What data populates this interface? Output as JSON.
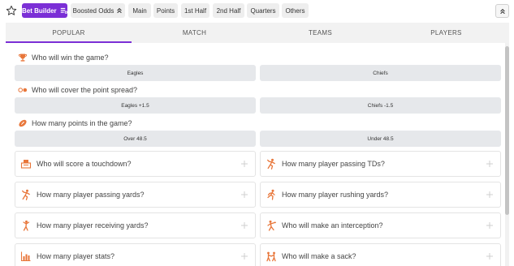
{
  "filters": {
    "bet_builder": "Bet Builder",
    "chips": [
      "Boosted Odds",
      "Main",
      "Points",
      "1st Half",
      "2nd Half",
      "Quarters",
      "Others"
    ]
  },
  "tabs": [
    "POPULAR",
    "MATCH",
    "TEAMS",
    "PLAYERS"
  ],
  "active_tab": "POPULAR",
  "questions": [
    {
      "title": "Who will win the game?",
      "icon": "trophy-icon",
      "options": [
        "Eagles",
        "Chiefs"
      ]
    },
    {
      "title": "Who will cover the point spread?",
      "icon": "spread-icon",
      "options": [
        "Eagles +1.5",
        "Chiefs -1.5"
      ]
    },
    {
      "title": "How many points in the game?",
      "icon": "football-icon",
      "options": [
        "Over 48.5",
        "Under 48.5"
      ]
    }
  ],
  "markets": [
    {
      "label": "Who will score a touchdown?",
      "icon": "touchdown-icon"
    },
    {
      "label": "How many player passing TDs?",
      "icon": "passer-icon"
    },
    {
      "label": "How many player passing yards?",
      "icon": "passer-icon"
    },
    {
      "label": "How many player rushing yards?",
      "icon": "runner-icon"
    },
    {
      "label": "How many player receiving yards?",
      "icon": "receiver-icon"
    },
    {
      "label": "Who will make an interception?",
      "icon": "interception-icon"
    },
    {
      "label": "How many player stats?",
      "icon": "stats-icon"
    },
    {
      "label": "Who will make a sack?",
      "icon": "sack-icon"
    }
  ],
  "colors": {
    "accent": "#7b2fd6",
    "icon_orange": "#e8763a",
    "option_bg": "#e6e8eb"
  }
}
